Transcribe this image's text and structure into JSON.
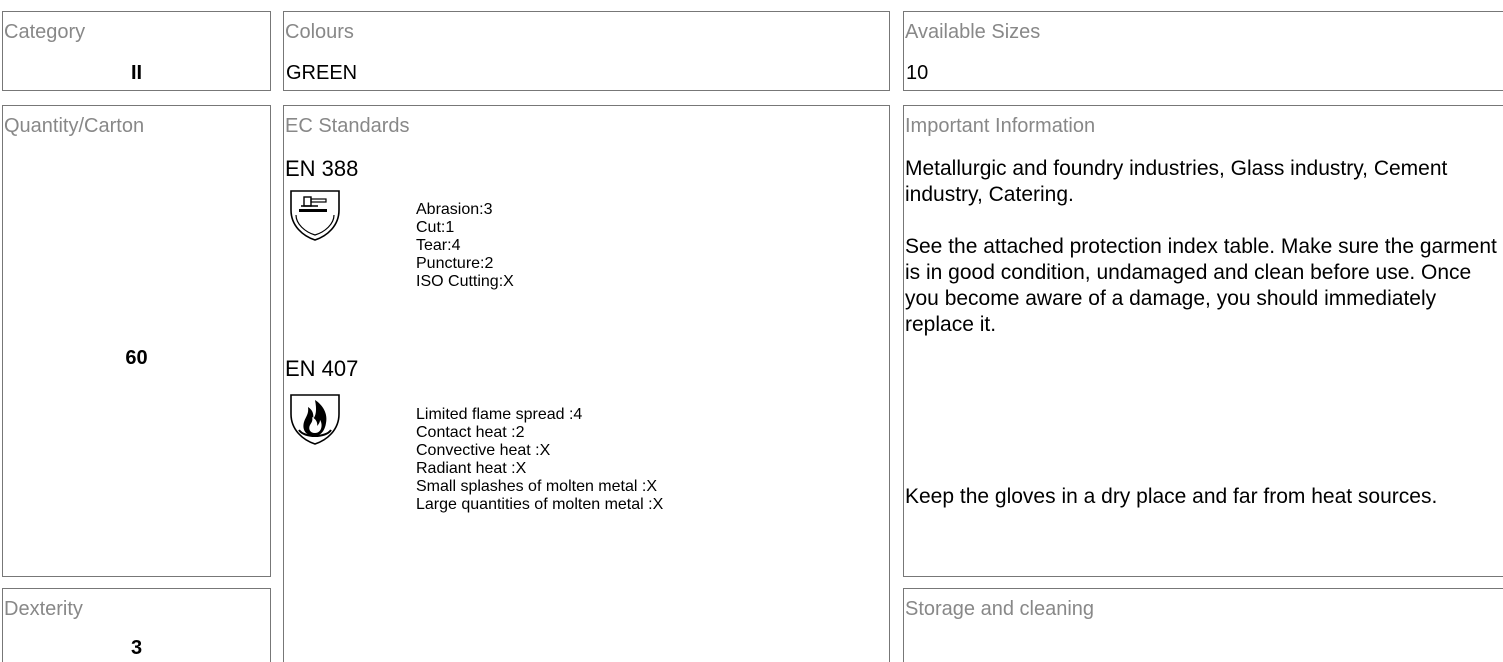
{
  "category": {
    "label": "Category",
    "value": "II"
  },
  "colours": {
    "label": "Colours",
    "value": "GREEN"
  },
  "sizes": {
    "label": "Available Sizes",
    "value": "10"
  },
  "quantity": {
    "label": "Quantity/Carton",
    "value": "60"
  },
  "dexterity": {
    "label": "Dexterity",
    "value": "3"
  },
  "ec_standards": {
    "label": "EC Standards",
    "standards": [
      {
        "code": "EN 388",
        "icon": "mechanical-hazard-shield-icon",
        "ratings": [
          "Abrasion:3",
          "Cut:1",
          "Tear:4",
          "Puncture:2",
          "ISO Cutting:X"
        ]
      },
      {
        "code": "EN 407",
        "icon": "heat-flame-shield-icon",
        "ratings": [
          "Limited flame spread :4",
          "Contact heat :2",
          "Convective heat :X",
          "Radiant heat :X",
          "Small splashes of molten metal :X",
          "Large quantities of molten metal :X"
        ]
      }
    ]
  },
  "important_information": {
    "label": "Important Information",
    "paragraphs": [
      "Metallurgic and foundry industries, Glass industry, Cement industry, Catering.",
      "See the attached protection index table. Make sure the garment is in good condition, undamaged and clean before use. Once you become aware of a damage, you should immediately replace it."
    ],
    "note": "Keep the gloves in a dry place and far from heat sources."
  },
  "storage": {
    "label": "Storage and cleaning"
  }
}
